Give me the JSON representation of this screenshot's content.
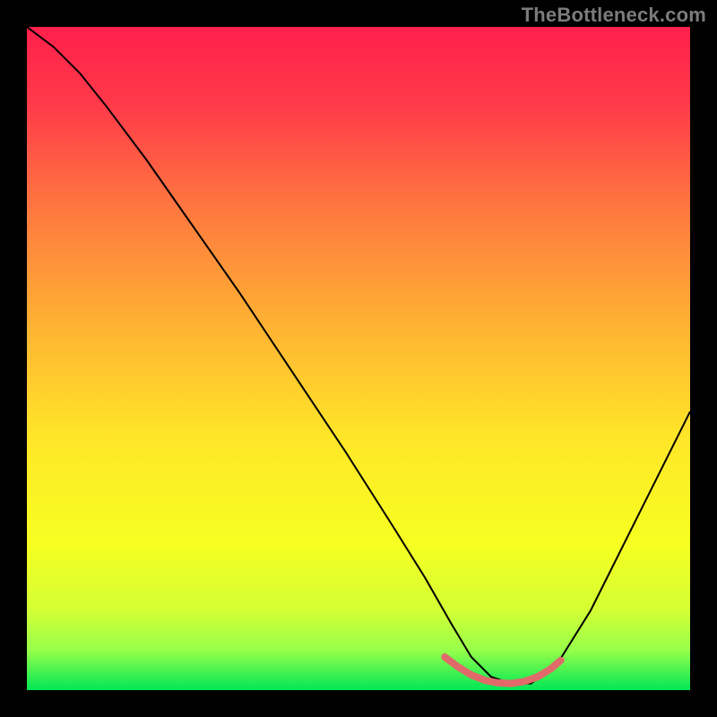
{
  "watermark": "TheBottleneck.com",
  "chart_data": {
    "type": "line",
    "title": "",
    "xlabel": "",
    "ylabel": "",
    "xlim": [
      0,
      100
    ],
    "ylim": [
      0,
      100
    ],
    "grid": false,
    "legend": false,
    "gradient_stops": [
      {
        "offset": 0.0,
        "color": "#ff1f4b"
      },
      {
        "offset": 0.12,
        "color": "#ff3b4a"
      },
      {
        "offset": 0.28,
        "color": "#ff7a3f"
      },
      {
        "offset": 0.45,
        "color": "#ffb233"
      },
      {
        "offset": 0.62,
        "color": "#ffe628"
      },
      {
        "offset": 0.78,
        "color": "#f6ff21"
      },
      {
        "offset": 0.88,
        "color": "#d3ff34"
      },
      {
        "offset": 0.94,
        "color": "#96ff4a"
      },
      {
        "offset": 1.0,
        "color": "#00e756"
      }
    ],
    "series": [
      {
        "name": "bottleneck-curve",
        "color": "#000000",
        "width": 2,
        "x": [
          0,
          4,
          8,
          12,
          18,
          25,
          32,
          40,
          48,
          55,
          60,
          64,
          67,
          70,
          73,
          76,
          80,
          85,
          90,
          95,
          100
        ],
        "y": [
          100,
          97,
          93,
          88,
          80,
          70,
          60,
          48,
          36,
          25,
          17,
          10,
          5,
          2,
          1,
          1,
          4,
          12,
          22,
          32,
          42
        ]
      }
    ],
    "highlight_segment": {
      "name": "optimal-range",
      "color": "#e06a6a",
      "width": 8,
      "x": [
        63,
        65,
        67,
        69,
        71,
        73,
        75,
        77,
        79,
        80.5
      ],
      "y": [
        5,
        3.5,
        2.3,
        1.5,
        1.1,
        1.0,
        1.3,
        2.0,
        3.2,
        4.5
      ]
    }
  }
}
